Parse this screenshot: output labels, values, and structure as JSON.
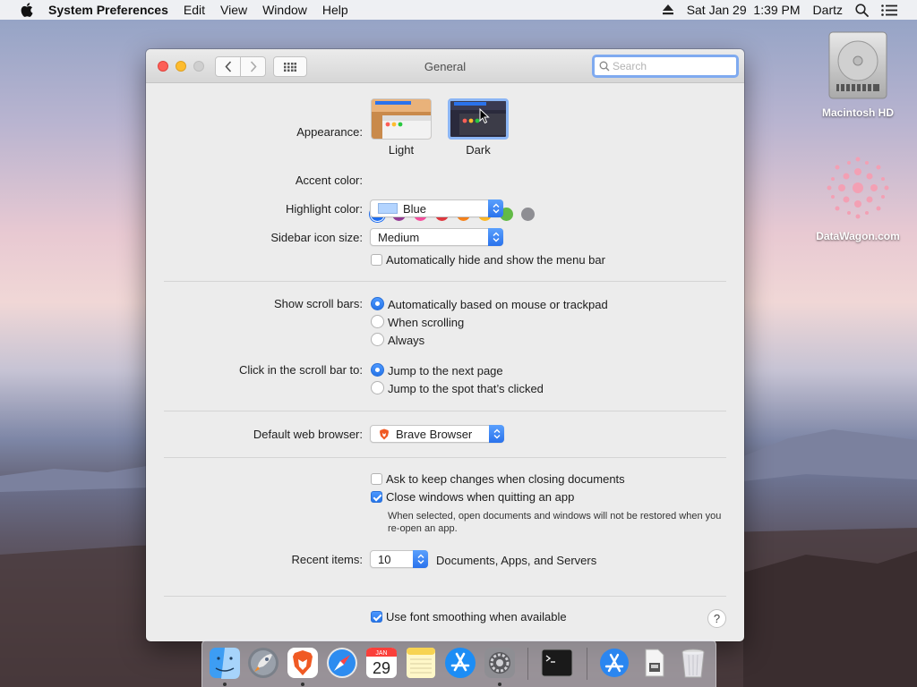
{
  "menubar": {
    "app_name": "System Preferences",
    "menus": [
      "Edit",
      "View",
      "Window",
      "Help"
    ],
    "datetime": "Sat Jan 29  1:39 PM",
    "user": "Dartz"
  },
  "desktop": {
    "icons": [
      {
        "label": "Macintosh HD",
        "icon": "hard-drive-icon"
      },
      {
        "label": "DataWagon.com",
        "icon": "datawagon-logo-icon"
      }
    ]
  },
  "window": {
    "title": "General",
    "search_placeholder": "Search"
  },
  "general": {
    "appearance": {
      "label": "Appearance:",
      "options": [
        {
          "label": "Light",
          "selected": false
        },
        {
          "label": "Dark",
          "selected": true
        }
      ]
    },
    "accent_color": {
      "label": "Accent color:",
      "colors": [
        "#1f6ff2",
        "#953d96",
        "#f74f9e",
        "#e0383e",
        "#f7821b",
        "#fcb827",
        "#62ba46",
        "#8e8e93"
      ],
      "selected_index": 0
    },
    "highlight_color": {
      "label": "Highlight color:",
      "value": "Blue",
      "swatch": "#b3d4ff"
    },
    "sidebar_icon_size": {
      "label": "Sidebar icon size:",
      "value": "Medium"
    },
    "auto_hide_menu_bar": {
      "label": "Automatically hide and show the menu bar",
      "checked": false
    },
    "show_scroll_bars": {
      "label": "Show scroll bars:",
      "options": [
        "Automatically based on mouse or trackpad",
        "When scrolling",
        "Always"
      ],
      "selected_index": 0
    },
    "click_scroll_bar": {
      "label": "Click in the scroll bar to:",
      "options": [
        "Jump to the next page",
        "Jump to the spot that’s clicked"
      ],
      "selected_index": 0
    },
    "default_browser": {
      "label": "Default web browser:",
      "value": "Brave Browser"
    },
    "ask_keep_changes": {
      "label": "Ask to keep changes when closing documents",
      "checked": false
    },
    "close_windows": {
      "label": "Close windows when quitting an app",
      "checked": true,
      "note": "When selected, open documents and windows will not be restored when you re-open an app."
    },
    "recent_items": {
      "label": "Recent items:",
      "value": "10",
      "suffix": "Documents, Apps, and Servers"
    },
    "font_smoothing": {
      "label": "Use font smoothing when available",
      "checked": true
    },
    "help_glyph": "?"
  },
  "dock": {
    "items": [
      {
        "name": "finder",
        "running": true
      },
      {
        "name": "launchpad",
        "running": false
      },
      {
        "name": "brave",
        "running": true
      },
      {
        "name": "safari",
        "running": false
      },
      {
        "name": "calendar",
        "running": false,
        "month": "JAN",
        "day": "29"
      },
      {
        "name": "notes",
        "running": false
      },
      {
        "name": "app-store",
        "running": false
      },
      {
        "name": "system-preferences",
        "running": true
      },
      {
        "name": "terminal",
        "running": false
      },
      {
        "name": "applications",
        "running": false
      },
      {
        "name": "downloads",
        "running": false
      },
      {
        "name": "trash",
        "running": false
      }
    ]
  }
}
